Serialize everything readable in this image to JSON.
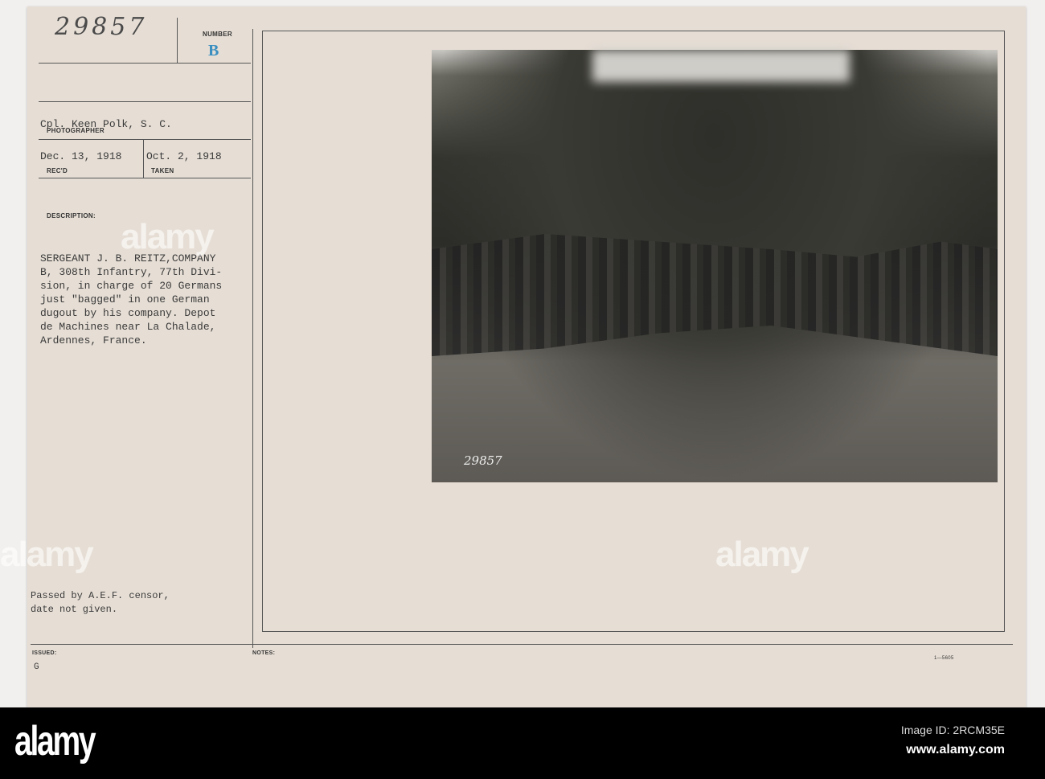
{
  "card": {
    "handwritten_number": "29857",
    "number_label": "NUMBER",
    "number_stamp": "B",
    "photographer": "Cpl. Keen Polk, S. C.",
    "photographer_label": "PHOTOGRAPHER",
    "received": "Dec. 13, 1918",
    "received_label": "REC'D",
    "taken": "Oct. 2, 1918",
    "taken_label": "TAKEN",
    "description_label": "DESCRIPTION:",
    "description": "SERGEANT J. B. REITZ,COMPANY\nB, 308th Infantry, 77th Divi-\nsion, in charge of 20 Germans\njust \"bagged\" in one German\ndugout by his company. Depot\nde Machines near La Chalade,\nArdennes, France.",
    "censor_note": "Passed by A.E.F. censor,\ndate not given.",
    "issued_label": "ISSUED:",
    "issued_value": "G",
    "notes_label": "NOTES:",
    "form_code": "1—5605",
    "photo_number": "29857"
  },
  "watermark": "alamy",
  "footer": {
    "logo": "alamy",
    "image_id": "Image ID: 2RCM35E",
    "url": "www.alamy.com"
  }
}
